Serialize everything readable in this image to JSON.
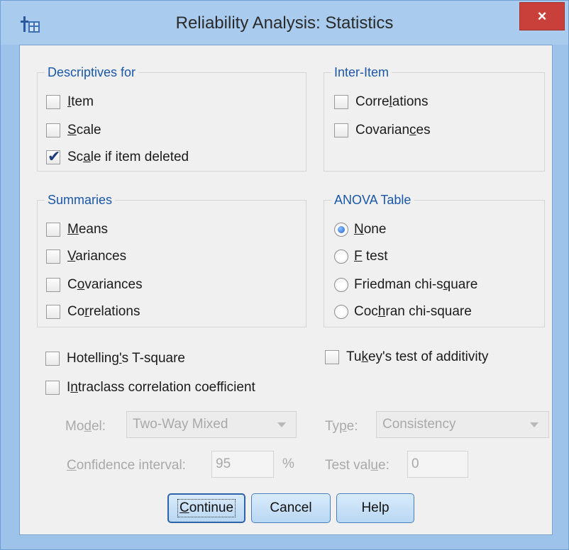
{
  "window": {
    "title": "Reliability Analysis: Statistics",
    "close_glyph": "×",
    "app_icon": "spss-table-icon"
  },
  "descriptives": {
    "label": "Descriptives for",
    "item": {
      "pre": "",
      "key": "I",
      "post": "tem",
      "checked": false
    },
    "scale": {
      "pre": "",
      "key": "S",
      "post": "cale",
      "checked": false
    },
    "scale_deleted": {
      "pre": "Sc",
      "key": "a",
      "post": "le if item deleted",
      "checked": true
    }
  },
  "inter_item": {
    "label": "Inter-Item",
    "correlations": {
      "pre": "Corre",
      "key": "l",
      "post": "ations",
      "checked": false
    },
    "covariances": {
      "pre": "Covarian",
      "key": "c",
      "post": "es",
      "checked": false
    }
  },
  "summaries": {
    "label": "Summaries",
    "means": {
      "pre": "",
      "key": "M",
      "post": "eans",
      "checked": false
    },
    "variances": {
      "pre": "",
      "key": "V",
      "post": "ariances",
      "checked": false
    },
    "covariances": {
      "pre": "C",
      "key": "o",
      "post": "variances",
      "checked": false
    },
    "correlations": {
      "pre": "Co",
      "key": "r",
      "post": "relations",
      "checked": false
    }
  },
  "anova": {
    "label": "ANOVA Table",
    "none": {
      "pre": "",
      "key": "N",
      "post": "one",
      "selected": true
    },
    "ftest": {
      "pre": "",
      "key": "F",
      "post": " test",
      "selected": false
    },
    "friedman": {
      "pre": "Friedman chi-s",
      "key": "q",
      "post": "uare",
      "selected": false
    },
    "cochran": {
      "pre": "Coc",
      "key": "h",
      "post": "ran chi-square",
      "selected": false
    }
  },
  "hotelling": {
    "pre": "Hotelling",
    "key": "'",
    "post": "s T-square",
    "checked": false
  },
  "tukey": {
    "pre": "Tu",
    "key": "k",
    "post": "ey's test of additivity",
    "checked": false
  },
  "intraclass": {
    "pre": "I",
    "key": "n",
    "post": "traclass correlation coefficient",
    "checked": false
  },
  "icc": {
    "model_label": {
      "pre": "Mo",
      "key": "d",
      "post": "el:"
    },
    "model_value": "Two-Way Mixed",
    "type_label": {
      "pre": "Ty",
      "key": "p",
      "post": "e:"
    },
    "type_value": "Consistency",
    "ci_label": {
      "pre": "",
      "key": "C",
      "post": "onfidence interval:"
    },
    "ci_value": "95",
    "ci_unit": "%",
    "test_label": {
      "pre": "Test val",
      "key": "u",
      "post": "e:"
    },
    "test_value": "0"
  },
  "buttons": {
    "continue": {
      "pre": "",
      "key": "C",
      "post": "ontinue"
    },
    "cancel": "Cancel",
    "help": "Help"
  }
}
